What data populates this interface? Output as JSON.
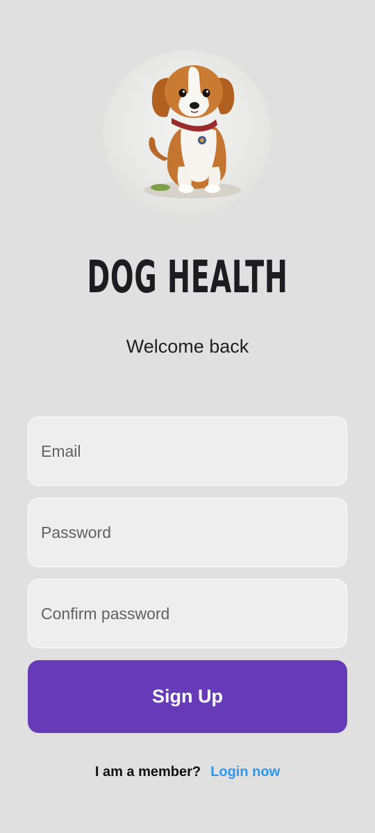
{
  "app": {
    "title": "DOG HEALTH",
    "subtitle": "Welcome back"
  },
  "form": {
    "email_placeholder": "Email",
    "password_placeholder": "Password",
    "confirm_placeholder": "Confirm password",
    "submit_label": "Sign Up"
  },
  "footer": {
    "member_text": "I am a member?",
    "login_link": "Login now"
  },
  "colors": {
    "background": "#e0e0e0",
    "primary": "#673ab7",
    "link": "#2d96f0",
    "field_bg": "#eeeeee"
  },
  "icons": {
    "avatar": "dog-puppy-illustration"
  }
}
